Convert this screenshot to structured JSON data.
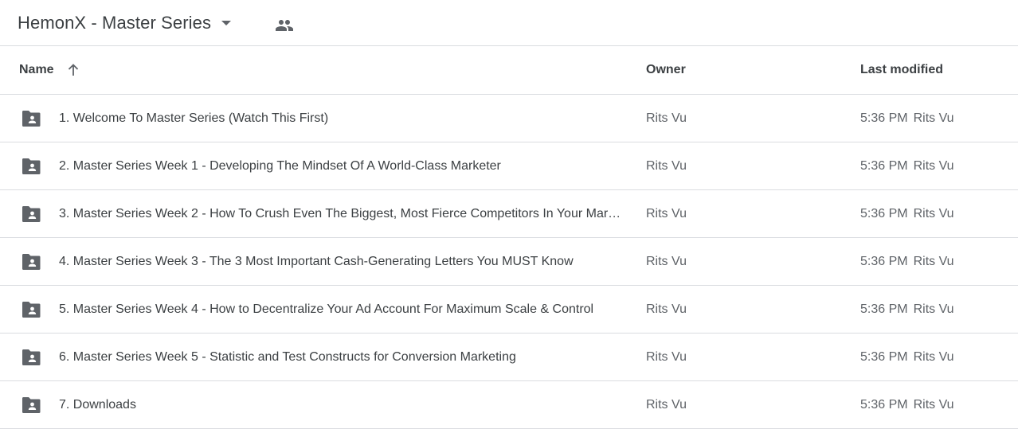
{
  "header": {
    "title": "HemonX - Master Series",
    "dropdown_icon": "arrow-drop-down-icon",
    "shared_icon": "people-icon"
  },
  "columns": {
    "name": "Name",
    "owner": "Owner",
    "last_modified": "Last modified",
    "sort_icon": "arrow-up-icon"
  },
  "colors": {
    "text": "#3c4043",
    "secondary_text": "#5f6368",
    "divider": "#dadce0"
  },
  "files": [
    {
      "name": "1. Welcome To Master Series (Watch This First)",
      "owner": "Rits Vu",
      "modified_time": "5:36 PM",
      "modified_by": "Rits Vu",
      "icon": "shared-folder-icon"
    },
    {
      "name": "2. Master Series Week 1 - Developing The Mindset Of A World-Class Marketer",
      "owner": "Rits Vu",
      "modified_time": "5:36 PM",
      "modified_by": "Rits Vu",
      "icon": "shared-folder-icon"
    },
    {
      "name": "3. Master Series Week 2 - How To Crush Even The Biggest, Most Fierce Competitors In Your Mar…",
      "owner": "Rits Vu",
      "modified_time": "5:36 PM",
      "modified_by": "Rits Vu",
      "icon": "shared-folder-icon"
    },
    {
      "name": "4. Master Series Week 3 - The 3 Most Important Cash-Generating Letters You MUST Know",
      "owner": "Rits Vu",
      "modified_time": "5:36 PM",
      "modified_by": "Rits Vu",
      "icon": "shared-folder-icon"
    },
    {
      "name": "5. Master Series Week 4 - How to Decentralize Your Ad Account For Maximum Scale & Control",
      "owner": "Rits Vu",
      "modified_time": "5:36 PM",
      "modified_by": "Rits Vu",
      "icon": "shared-folder-icon"
    },
    {
      "name": "6. Master Series Week 5 - Statistic and Test Constructs for Conversion Marketing",
      "owner": "Rits Vu",
      "modified_time": "5:36 PM",
      "modified_by": "Rits Vu",
      "icon": "shared-folder-icon"
    },
    {
      "name": "7. Downloads",
      "owner": "Rits Vu",
      "modified_time": "5:36 PM",
      "modified_by": "Rits Vu",
      "icon": "shared-folder-icon"
    }
  ]
}
